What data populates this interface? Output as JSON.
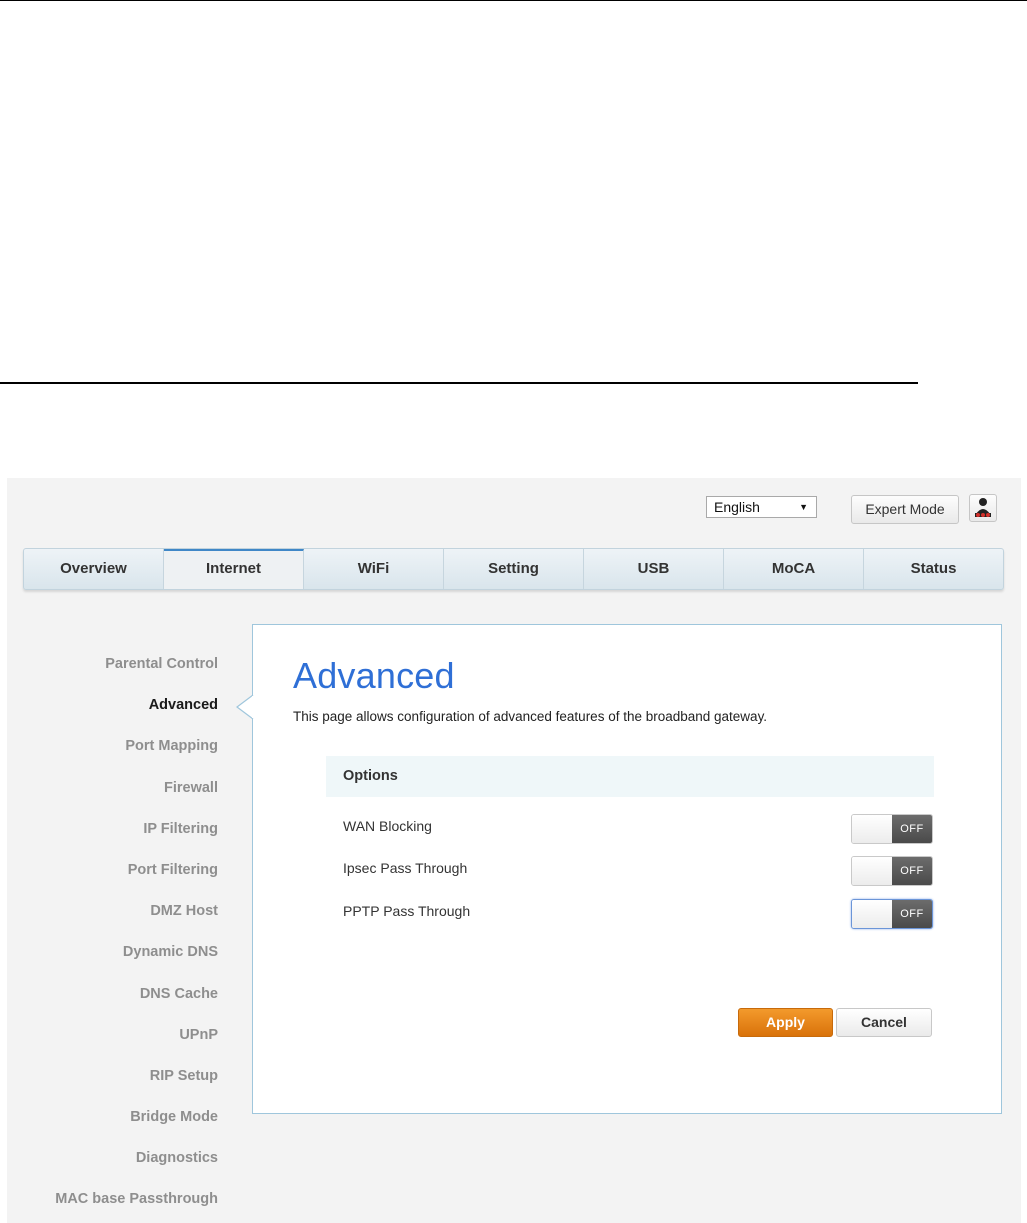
{
  "header": {
    "language": "English",
    "expert_mode_label": "Expert Mode",
    "user_icon": "user-icon"
  },
  "tabs": [
    {
      "label": "Overview"
    },
    {
      "label": "Internet",
      "active": true
    },
    {
      "label": "WiFi"
    },
    {
      "label": "Setting"
    },
    {
      "label": "USB"
    },
    {
      "label": "MoCA"
    },
    {
      "label": "Status"
    }
  ],
  "sidebar": {
    "items": [
      {
        "label": "Parental Control"
      },
      {
        "label": "Advanced",
        "active": true
      },
      {
        "label": "Port Mapping"
      },
      {
        "label": "Firewall"
      },
      {
        "label": "IP Filtering"
      },
      {
        "label": "Port Filtering"
      },
      {
        "label": "DMZ Host"
      },
      {
        "label": "Dynamic DNS"
      },
      {
        "label": "DNS Cache"
      },
      {
        "label": "UPnP"
      },
      {
        "label": "RIP Setup"
      },
      {
        "label": "Bridge Mode"
      },
      {
        "label": "Diagnostics"
      },
      {
        "label": "MAC base Passthrough"
      }
    ]
  },
  "main": {
    "title": "Advanced",
    "description": "This page allows configuration of advanced features of the broadband gateway.",
    "options_header": "Options",
    "options": [
      {
        "label": "WAN Blocking",
        "state": "OFF"
      },
      {
        "label": "Ipsec Pass Through",
        "state": "OFF"
      },
      {
        "label": "PPTP Pass Through",
        "state": "OFF"
      }
    ],
    "apply_label": "Apply",
    "cancel_label": "Cancel"
  },
  "colors": {
    "title_blue": "#2f6fd6",
    "apply_orange": "#e8841a",
    "panel_border": "#9fc6dc"
  }
}
